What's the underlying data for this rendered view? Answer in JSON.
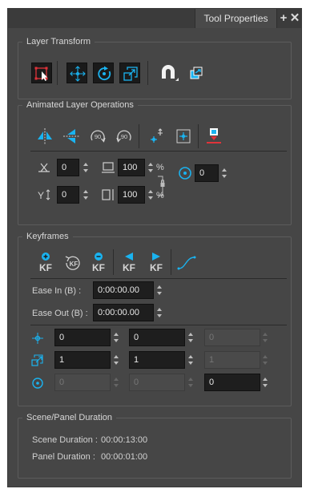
{
  "tab": {
    "title": "Tool Properties",
    "add_icon": "plus-icon",
    "close_icon": "close-icon"
  },
  "colors": {
    "accent": "#1ab3f0",
    "panel": "#464646",
    "field": "#1e1e1e",
    "red": "#e0333a"
  },
  "layer_transform": {
    "title": "Layer Transform",
    "tools": [
      "select-tool-icon",
      "translate-icon",
      "rotate-icon",
      "scale-icon",
      "magnet-snap-icon",
      "copy-layers-icon"
    ]
  },
  "animated_ops": {
    "title": "Animated Layer Operations",
    "tools": [
      "flip-horizontal-icon",
      "flip-vertical-icon",
      "rotate-90-cw-icon",
      "rotate-90-ccw-icon",
      "reset-pivot-icon",
      "center-pivot-icon",
      "collapse-icon"
    ],
    "skew": {
      "value": "0"
    },
    "width": {
      "value": "100",
      "unit": "%"
    },
    "y_offset": {
      "value": "0"
    },
    "height": {
      "value": "100",
      "unit": "%"
    },
    "angle": {
      "value": "0"
    }
  },
  "keyframes": {
    "title": "Keyframes",
    "kf_label": "KF",
    "ease_in": {
      "label": "Ease In (B) :",
      "value": "0:00:00.00"
    },
    "ease_out": {
      "label": "Ease Out (B) :",
      "value": "0:00:00.00"
    },
    "position": [
      "0",
      "0",
      "0"
    ],
    "scale": [
      "1",
      "1",
      "1"
    ],
    "rotation": [
      "0",
      "0",
      "0"
    ]
  },
  "scene": {
    "title": "Scene/Panel Duration",
    "scene_label": "Scene Duration :",
    "scene_value": "00:00:13:00",
    "panel_label": "Panel Duration :",
    "panel_value": "00:00:01:00"
  }
}
